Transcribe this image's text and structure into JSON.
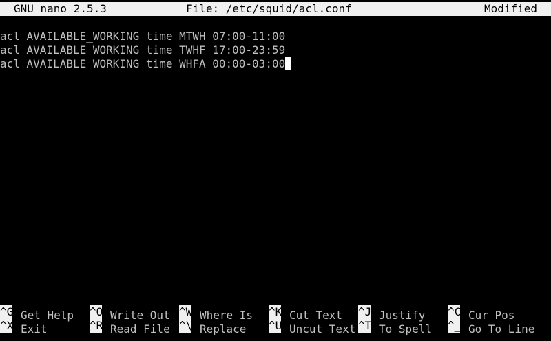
{
  "title_bar": {
    "app": "GNU nano 2.5.3",
    "file": "File: /etc/squid/acl.conf",
    "status": "Modified"
  },
  "editor": {
    "lines": [
      "acl AVAILABLE_WORKING time MTWH 07:00-11:00",
      "acl AVAILABLE_WORKING time TWHF 17:00-23:59",
      "acl AVAILABLE_WORKING time WHFA 00:00-03:00"
    ]
  },
  "shortcuts": {
    "row1": [
      {
        "key": "^G",
        "label": "Get Help"
      },
      {
        "key": "^O",
        "label": "Write Out"
      },
      {
        "key": "^W",
        "label": "Where Is"
      },
      {
        "key": "^K",
        "label": "Cut Text"
      },
      {
        "key": "^J",
        "label": "Justify"
      },
      {
        "key": "^C",
        "label": "Cur Pos"
      }
    ],
    "row2": [
      {
        "key": "^X",
        "label": "Exit"
      },
      {
        "key": "^R",
        "label": "Read File"
      },
      {
        "key": "^\\",
        "label": "Replace"
      },
      {
        "key": "^U",
        "label": "Uncut Text"
      },
      {
        "key": "^T",
        "label": "To Spell"
      },
      {
        "key": "^_",
        "label": "Go To Line"
      }
    ]
  },
  "colors": {
    "background": "#000000",
    "text": "#c0c0c0",
    "bar_background": "#f0f0f0",
    "bar_text": "#000000",
    "cursor": "#ffffff"
  }
}
